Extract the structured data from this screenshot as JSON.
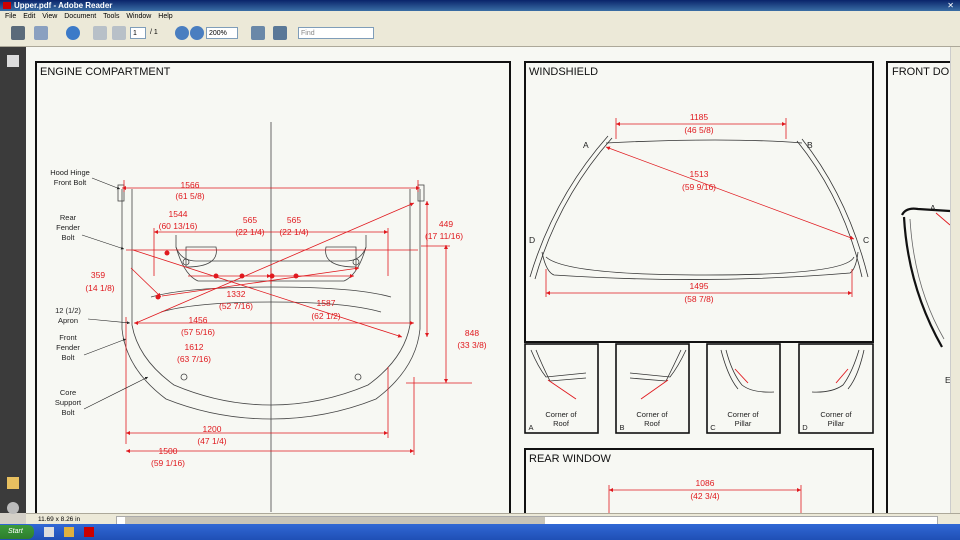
{
  "window": {
    "title": "Upper.pdf - Adobe Reader"
  },
  "menu": [
    "File",
    "Edit",
    "View",
    "Document",
    "Tools",
    "Window",
    "Help"
  ],
  "toolbar": {
    "page_current": "1",
    "page_total": "/ 1",
    "zoom": "200%",
    "find_placeholder": "Find"
  },
  "status": {
    "page_size": "11.69 x 8.26 in"
  },
  "taskbar": {
    "start_label": "Start"
  },
  "drawing": {
    "engine": {
      "title": "ENGINE COMPARTMENT",
      "labels": {
        "hood_hinge": [
          "Hood Hinge",
          "Front Bolt"
        ],
        "rear_fender": [
          "Rear",
          "Fender",
          "Bolt"
        ],
        "apron": [
          "12 (1/2)",
          "Apron"
        ],
        "front_fender": [
          "Front",
          "Fender",
          "Bolt"
        ],
        "core_support": [
          "Core",
          "Support",
          "Bolt"
        ]
      },
      "dims": {
        "d1566": [
          "1566",
          "(61 5/8)"
        ],
        "d1544": [
          "1544",
          "(60 13/16)"
        ],
        "d565a": [
          "565",
          "(22 1/4)"
        ],
        "d565b": [
          "565",
          "(22 1/4)"
        ],
        "d449": [
          "449",
          "(17 11/16)"
        ],
        "d359": [
          "359",
          "(14 1/8)"
        ],
        "d1332": [
          "1332",
          "(52 7/16)"
        ],
        "d1587": [
          "1587",
          "(62 1/2)"
        ],
        "d1456": [
          "1456",
          "(57 5/16)"
        ],
        "d1612": [
          "1612",
          "(63 7/16)"
        ],
        "d848": [
          "848",
          "(33 3/8)"
        ],
        "d1200": [
          "1200",
          "(47 1/4)"
        ],
        "d1500": [
          "1500",
          "(59 1/16)"
        ]
      }
    },
    "windshield": {
      "title": "WINDSHIELD",
      "dims": {
        "d1185": [
          "1185",
          "(46 5/8)"
        ],
        "d1513": [
          "1513",
          "(59 9/16)"
        ],
        "d1495": [
          "1495",
          "(58 7/8)"
        ]
      },
      "points": [
        "A",
        "B",
        "C",
        "D"
      ],
      "corners": [
        {
          "letter": "A",
          "caption": [
            "Corner of",
            "Roof"
          ]
        },
        {
          "letter": "B",
          "caption": [
            "Corner of",
            "Roof"
          ]
        },
        {
          "letter": "C",
          "caption": [
            "Corner of",
            "Pillar"
          ]
        },
        {
          "letter": "D",
          "caption": [
            "Corner of",
            "Pillar"
          ]
        }
      ]
    },
    "rear_window": {
      "title": "REAR WINDOW",
      "dims": {
        "d1086": [
          "1086",
          "(42 3/4)"
        ]
      }
    },
    "front_door": {
      "title": "FRONT DO",
      "point": "A",
      "point2": "E"
    }
  },
  "colors": {
    "dimension": "#e0191e",
    "line": "#222222",
    "background": "#f7f8f3"
  }
}
